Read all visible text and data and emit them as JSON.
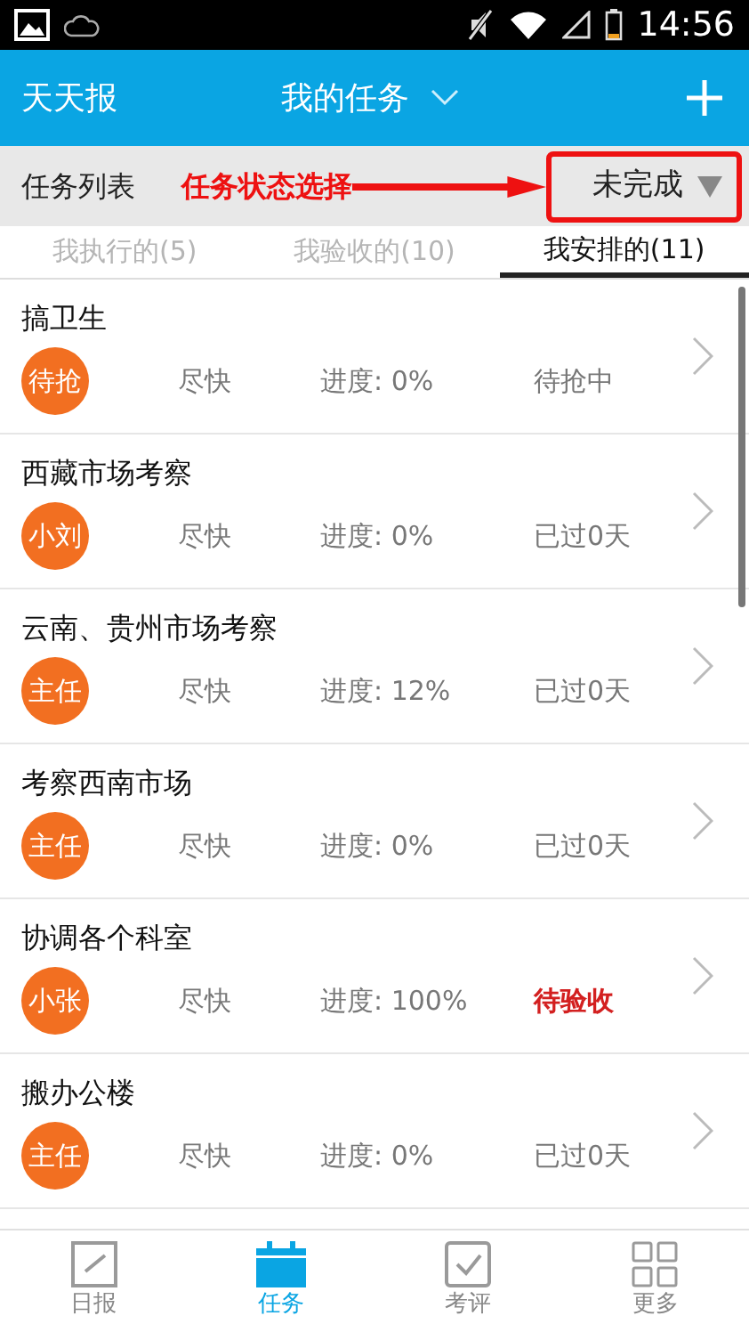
{
  "status_bar": {
    "time": "14:56"
  },
  "header": {
    "app_name": "天天报",
    "title": "我的任务"
  },
  "filter_bar": {
    "label": "任务列表",
    "annotation": "任务状态选择",
    "status_value": "未完成"
  },
  "tabs": [
    {
      "label": "我执行的(5)",
      "selected": false
    },
    {
      "label": "我验收的(10)",
      "selected": false
    },
    {
      "label": "我安排的(11)",
      "selected": true
    }
  ],
  "tasks": [
    {
      "title": "搞卫生",
      "assignee": "待抢",
      "priority": "尽快",
      "progress": "进度: 0%",
      "status": "待抢中",
      "highlight": false
    },
    {
      "title": "西藏市场考察",
      "assignee": "小刘",
      "priority": "尽快",
      "progress": "进度: 0%",
      "status": "已过0天",
      "highlight": false
    },
    {
      "title": "云南、贵州市场考察",
      "assignee": "主任",
      "priority": "尽快",
      "progress": "进度: 12%",
      "status": "已过0天",
      "highlight": false
    },
    {
      "title": "考察西南市场",
      "assignee": "主任",
      "priority": "尽快",
      "progress": "进度: 0%",
      "status": "已过0天",
      "highlight": false
    },
    {
      "title": "协调各个科室",
      "assignee": "小张",
      "priority": "尽快",
      "progress": "进度: 100%",
      "status": "待验收",
      "highlight": true
    },
    {
      "title": "搬办公楼",
      "assignee": "主任",
      "priority": "尽快",
      "progress": "进度: 0%",
      "status": "已过0天",
      "highlight": false
    }
  ],
  "bottom_nav": [
    {
      "label": "日报",
      "kind": "report",
      "selected": false
    },
    {
      "label": "任务",
      "kind": "task",
      "selected": true
    },
    {
      "label": "考评",
      "kind": "review",
      "selected": false
    },
    {
      "label": "更多",
      "kind": "more",
      "selected": false
    }
  ]
}
